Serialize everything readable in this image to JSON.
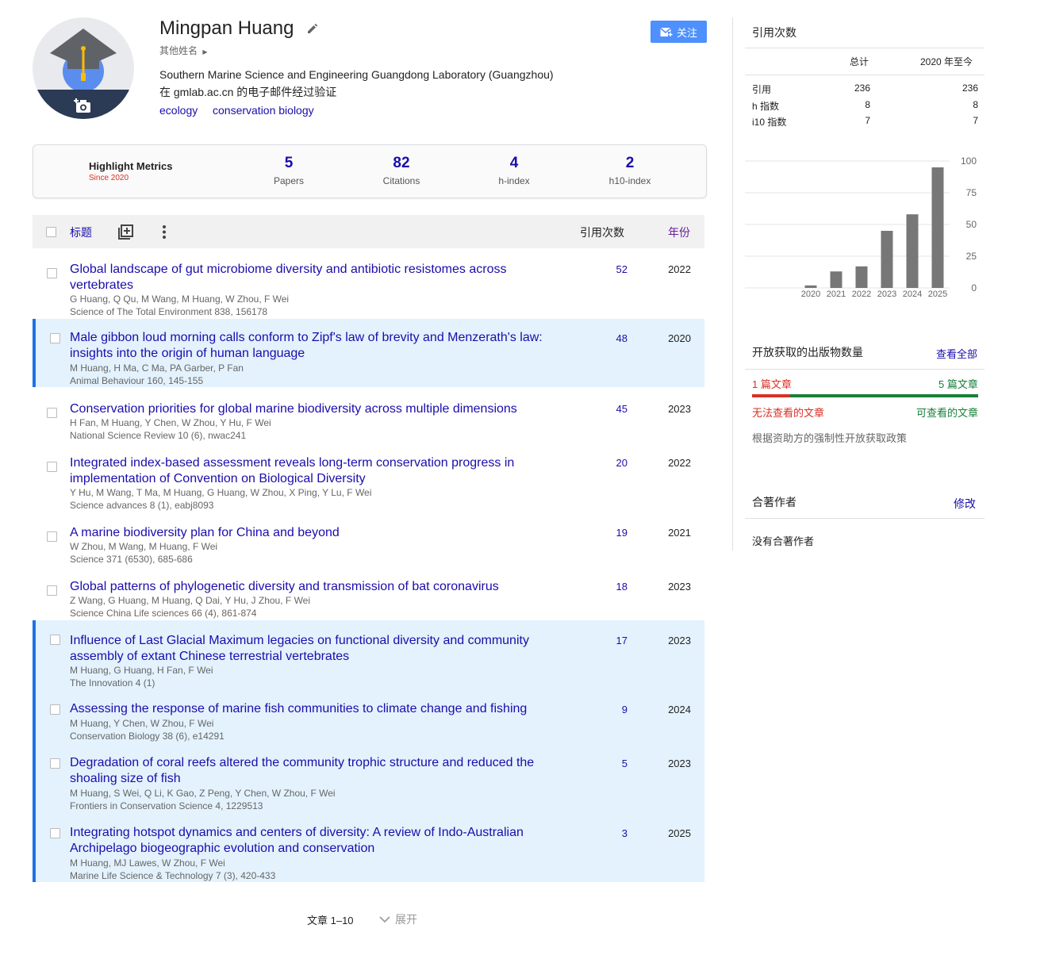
{
  "profile": {
    "name": "Mingpan Huang",
    "other_names_label": "其他姓名",
    "affiliation": "Southern Marine Science and Engineering Guangdong Laboratory (Guangzhou)",
    "email_verified": "在 gmlab.ac.cn 的电子邮件经过验证",
    "keywords": [
      "ecology",
      "conservation biology"
    ],
    "follow_label": "关注"
  },
  "highlight": {
    "title": "Highlight Metrics",
    "since": "Since 2020",
    "metrics": [
      {
        "value": "5",
        "label": "Papers"
      },
      {
        "value": "82",
        "label": "Citations"
      },
      {
        "value": "4",
        "label": "h-index"
      },
      {
        "value": "2",
        "label": "h10-index"
      }
    ]
  },
  "table": {
    "header": {
      "title": "标题",
      "cited_by": "引用次数",
      "year": "年份"
    },
    "rows": [
      {
        "title": "Global landscape of gut microbiome diversity and antibiotic resistomes across vertebrates",
        "authors": "G Huang, Q Qu, M Wang, M Huang, W Zhou, F Wei",
        "venue": "Science of The Total Environment 838, 156178",
        "cites": "52",
        "year": "2022",
        "selected": false
      },
      {
        "title": "Male gibbon loud morning calls conform to Zipf's law of brevity and Menzerath's law: insights into the origin of human language",
        "authors": "M Huang, H Ma, C Ma, PA Garber, P Fan",
        "venue": "Animal Behaviour 160, 145-155",
        "cites": "48",
        "year": "2020",
        "selected": true
      },
      {
        "title": "Conservation priorities for global marine biodiversity across multiple dimensions",
        "authors": "H Fan, M Huang, Y Chen, W Zhou, Y Hu, F Wei",
        "venue": "National Science Review 10 (6), nwac241",
        "cites": "45",
        "year": "2023",
        "selected": false
      },
      {
        "title": "Integrated index-based assessment reveals long-term conservation progress in implementation of Convention on Biological Diversity",
        "authors": "Y Hu, M Wang, T Ma, M Huang, G Huang, W Zhou, X Ping, Y Lu, F Wei",
        "venue": "Science advances 8 (1), eabj8093",
        "cites": "20",
        "year": "2022",
        "selected": false
      },
      {
        "title": "A marine biodiversity plan for China and beyond",
        "authors": "W Zhou, M Wang, M Huang, F Wei",
        "venue": "Science 371 (6530), 685-686",
        "cites": "19",
        "year": "2021",
        "selected": false
      },
      {
        "title": "Global patterns of phylogenetic diversity and transmission of bat coronavirus",
        "authors": "Z Wang, G Huang, M Huang, Q Dai, Y Hu, J Zhou, F Wei",
        "venue": "Science China Life sciences 66 (4), 861-874",
        "cites": "18",
        "year": "2023",
        "selected": false
      },
      {
        "title": "Influence of Last Glacial Maximum legacies on functional diversity and community assembly of extant Chinese terrestrial vertebrates",
        "authors": "M Huang, G Huang, H Fan, F Wei",
        "venue": "The Innovation 4 (1)",
        "cites": "17",
        "year": "2023",
        "selected": true
      },
      {
        "title": "Assessing the response of marine fish communities to climate change and fishing",
        "authors": "M Huang, Y Chen, W Zhou, F Wei",
        "venue": "Conservation Biology 38 (6), e14291",
        "cites": "9",
        "year": "2024",
        "selected": true
      },
      {
        "title": "Degradation of coral reefs altered the community trophic structure and reduced the shoaling size of fish",
        "authors": "M Huang, S Wei, Q Li, K Gao, Z Peng, Y Chen, W Zhou, F Wei",
        "venue": "Frontiers in Conservation Science 4, 1229513",
        "cites": "5",
        "year": "2023",
        "selected": true
      },
      {
        "title": "Integrating hotspot dynamics and centers of diversity: A review of Indo-Australian Archipelago biogeographic evolution and conservation",
        "authors": "M Huang, MJ Lawes, W Zhou, F Wei",
        "venue": "Marine Life Science & Technology 7 (3), 420-433",
        "cites": "3",
        "year": "2025",
        "selected": true
      }
    ],
    "pager": "文章 1–10",
    "expand_label": "展开"
  },
  "cited_by": {
    "title": "引用次数",
    "col_all": "总计",
    "col_since": "2020 年至今",
    "rows": [
      {
        "label": "引用",
        "all": "236",
        "since": "236"
      },
      {
        "label": "h 指数",
        "all": "8",
        "since": "8"
      },
      {
        "label": "i10 指数",
        "all": "7",
        "since": "7"
      }
    ]
  },
  "chart_data": {
    "type": "bar",
    "categories": [
      "2020",
      "2021",
      "2022",
      "2023",
      "2024",
      "2025"
    ],
    "values": [
      2,
      13,
      17,
      45,
      58,
      95
    ],
    "ylim": [
      0,
      100
    ],
    "yticks": [
      0,
      25,
      50,
      75,
      100
    ],
    "grid": true,
    "bar_color": "#777777"
  },
  "open_access": {
    "title": "开放获取的出版物数量",
    "view_all": "查看全部",
    "unavailable_count": "1 篇文章",
    "available_count": "5 篇文章",
    "unavailable_label": "无法查看的文章",
    "available_label": "可查看的文章",
    "unavailable_fraction": 0.1667,
    "mandate_note": "根据资助方的强制性开放获取政策",
    "red": "#d93025",
    "green": "#188038"
  },
  "coauthors": {
    "title": "合著作者",
    "edit_label": "修改",
    "empty": "没有合著作者"
  }
}
